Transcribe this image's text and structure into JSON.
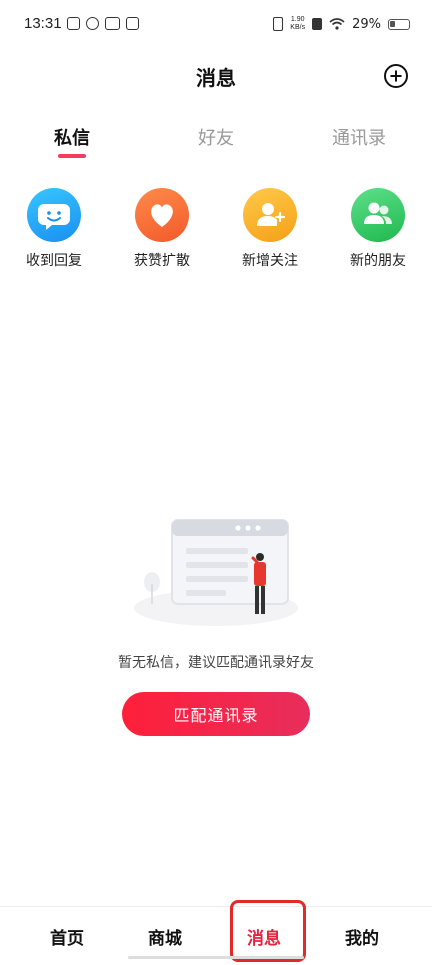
{
  "status_bar": {
    "time": "13:31",
    "net_speed_value": "1.90",
    "net_speed_unit": "KB/s",
    "battery": "29%"
  },
  "header": {
    "title": "消息",
    "add_icon": "plus-circle-icon"
  },
  "tabs": [
    {
      "label": "私信",
      "active": true
    },
    {
      "label": "好友",
      "active": false
    },
    {
      "label": "通讯录",
      "active": false
    }
  ],
  "quick_actions": [
    {
      "label": "收到回复",
      "icon": "smile-chat-icon",
      "color": "#1a8ff0"
    },
    {
      "label": "获赞扩散",
      "icon": "heart-icon",
      "color": "#f25a2a"
    },
    {
      "label": "新增关注",
      "icon": "add-person-icon",
      "color": "#f5a017"
    },
    {
      "label": "新的朋友",
      "icon": "friends-icon",
      "color": "#1fb84e"
    }
  ],
  "empty_state": {
    "message": "暂无私信，建议匹配通讯录好友",
    "button_label": "匹配通讯录"
  },
  "bottom_nav": [
    {
      "label": "首页",
      "active": false
    },
    {
      "label": "商城",
      "active": false
    },
    {
      "label": "消息",
      "active": true
    },
    {
      "label": "我的",
      "active": false
    }
  ],
  "colors": {
    "accent": "#e5233f",
    "button_gradient_start": "#ff1f3a",
    "button_gradient_end": "#e82d5c"
  }
}
